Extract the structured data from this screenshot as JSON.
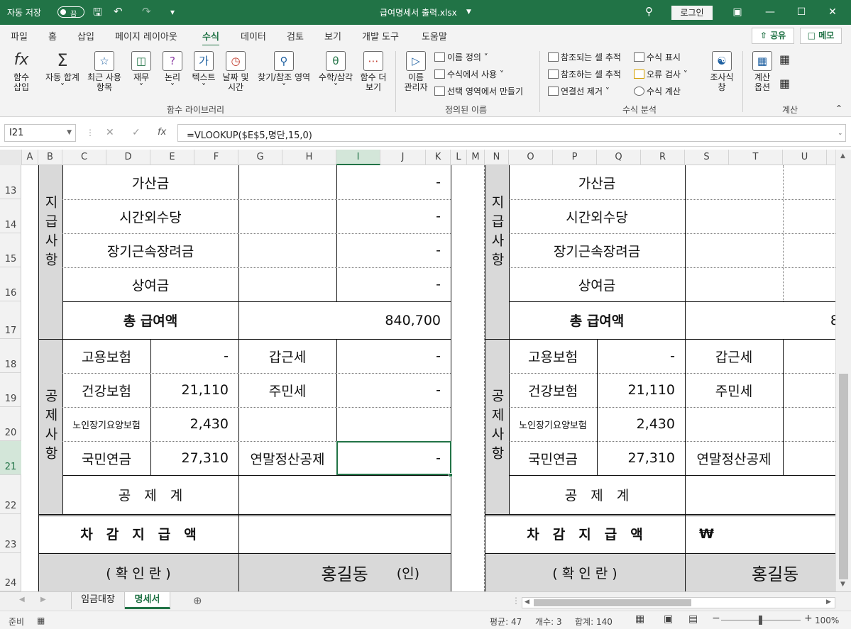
{
  "title_bar": {
    "autosave_label": "자동 저장",
    "autosave_state": "끔",
    "file_name": "급여명세서 출력.xlsx",
    "login": "로그인",
    "icons": [
      "save-icon",
      "undo-icon",
      "redo-icon",
      "customize-icon",
      "search-icon",
      "ribbon-display-icon",
      "minimize-icon",
      "maximize-icon",
      "close-icon"
    ]
  },
  "menu_tabs": [
    "파일",
    "홈",
    "삽입",
    "페이지 레이아웃",
    "수식",
    "데이터",
    "검토",
    "보기",
    "개발 도구",
    "도움말"
  ],
  "active_tab": "수식",
  "share_label": "공유",
  "memo_label": "메모",
  "ribbon": {
    "function_library": {
      "label": "함수 라이브러리",
      "buttons": [
        "함수\n삽입",
        "자동 합계",
        "최근 사용\n항목",
        "재무",
        "논리",
        "텍스트",
        "날짜 및\n시간",
        "찾기/참조 영역",
        "수학/삼각",
        "함수 더\n보기"
      ]
    },
    "defined_names": {
      "label": "정의된 이름",
      "manager": "이름\n관리자",
      "items": [
        "이름 정의",
        "수식에서 사용",
        "선택 영역에서 만들기"
      ]
    },
    "formula_auditing": {
      "label": "수식 분석",
      "items": [
        "참조되는 셀 추적",
        "참조하는 셀 추적",
        "연결선 제거",
        "수식 표시",
        "오류 검사",
        "수식 계산"
      ],
      "watch": "조사식\n창"
    },
    "calculation": {
      "label": "계산",
      "options": "계산\n옵션"
    }
  },
  "formula_bar": {
    "name_box": "I21",
    "formula": "=VLOOKUP($E$5,명단,15,0)",
    "cancel": "✕",
    "enter": "✓",
    "fx": "fx"
  },
  "columns": [
    "A",
    "B",
    "C",
    "D",
    "E",
    "F",
    "G",
    "H",
    "I",
    "J",
    "K",
    "L",
    "M",
    "N",
    "O",
    "P",
    "Q",
    "R",
    "S",
    "T",
    "U"
  ],
  "selected_column": "I",
  "rows": [
    "13",
    "14",
    "15",
    "16",
    "17",
    "18",
    "19",
    "20",
    "21",
    "22",
    "23",
    "24"
  ],
  "selected_row": "21",
  "left_slip": {
    "pay_section": "지급사항",
    "deduct_section": "공제사항",
    "pay_items": [
      "가산금",
      "시간외수당",
      "장기근속장려금",
      "상여금"
    ],
    "pay_values": [
      "-",
      "-",
      "-",
      "-"
    ],
    "total_pay_label": "총 급여액",
    "total_pay_value": "840,700",
    "deduct_left": [
      "고용보험",
      "건강보험",
      "노인장기요양보험",
      "국민연금"
    ],
    "deduct_left_values": [
      "-",
      "21,110",
      "2,430",
      "27,310"
    ],
    "deduct_right": [
      "갑근세",
      "주민세",
      "",
      "연말정산공제"
    ],
    "deduct_right_values": [
      "-",
      "-",
      "",
      "-"
    ],
    "deduct_total_label": "공　제　계",
    "net_pay_label": "차　감　지　급　액",
    "confirm_label": "( 확 인 란 )",
    "signer": "홍길동",
    "seal": "(인)"
  },
  "right_slip": {
    "pay_section": "지급사항",
    "deduct_section": "공제사항",
    "pay_items": [
      "가산금",
      "시간외수당",
      "장기근속장려금",
      "상여금"
    ],
    "total_pay_label": "총 급여액",
    "total_pay_partial": "8",
    "deduct_left": [
      "고용보험",
      "건강보험",
      "노인장기요양보험",
      "국민연금"
    ],
    "deduct_left_values": [
      "-",
      "21,110",
      "2,430",
      "27,310"
    ],
    "deduct_right": [
      "갑근세",
      "주민세",
      "",
      "연말정산공제"
    ],
    "deduct_total_label": "공　제　계",
    "net_pay_label": "차　감　지　급　액",
    "net_pay_currency": "₩",
    "confirm_label": "( 확 인 란 )",
    "signer": "홍길동"
  },
  "sheet_tabs": [
    "임금대장",
    "명세서"
  ],
  "active_sheet": "명세서",
  "status_bar": {
    "mode": "준비",
    "average": "평균: 47",
    "count": "개수: 3",
    "sum": "합계: 140",
    "zoom": "100%"
  }
}
